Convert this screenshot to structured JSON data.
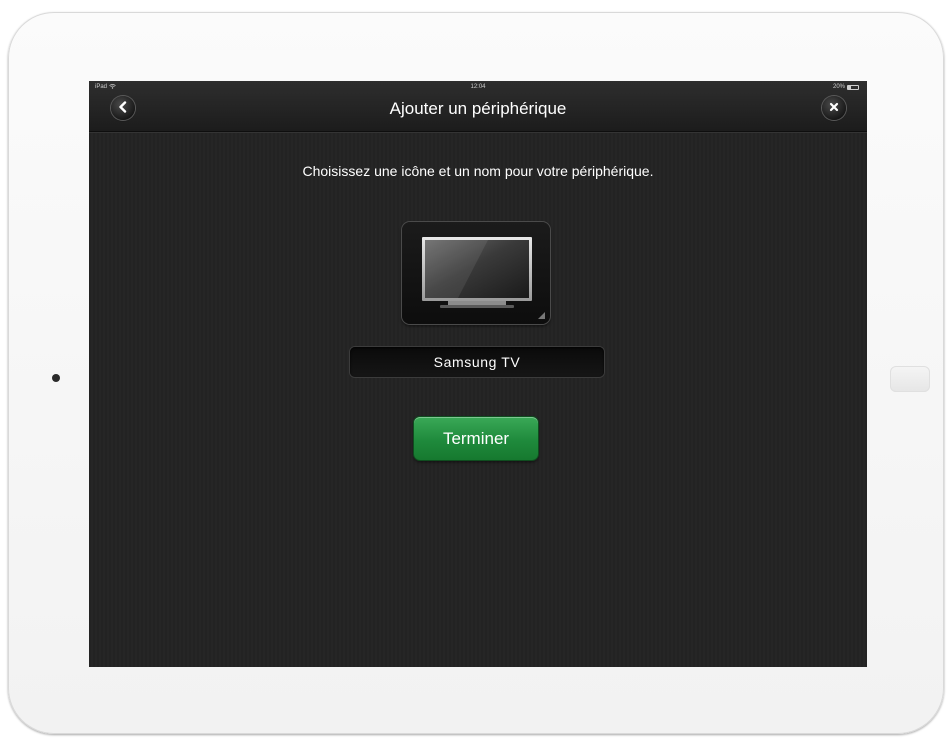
{
  "status_bar": {
    "device_label": "iPad",
    "time": "12:04",
    "battery": "20%"
  },
  "navbar": {
    "title": "Ajouter un périphérique",
    "back_icon": "chevron-left-icon",
    "close_icon": "close-icon"
  },
  "main": {
    "instruction": "Choisissez une icône et un nom pour votre périphérique.",
    "device_icon": "tv-icon",
    "device_name_value": "Samsung TV",
    "done_button_label": "Terminer"
  },
  "colors": {
    "accent_green": "#1f8a3c",
    "screen_background": "#242424",
    "text_primary": "#ffffff"
  }
}
